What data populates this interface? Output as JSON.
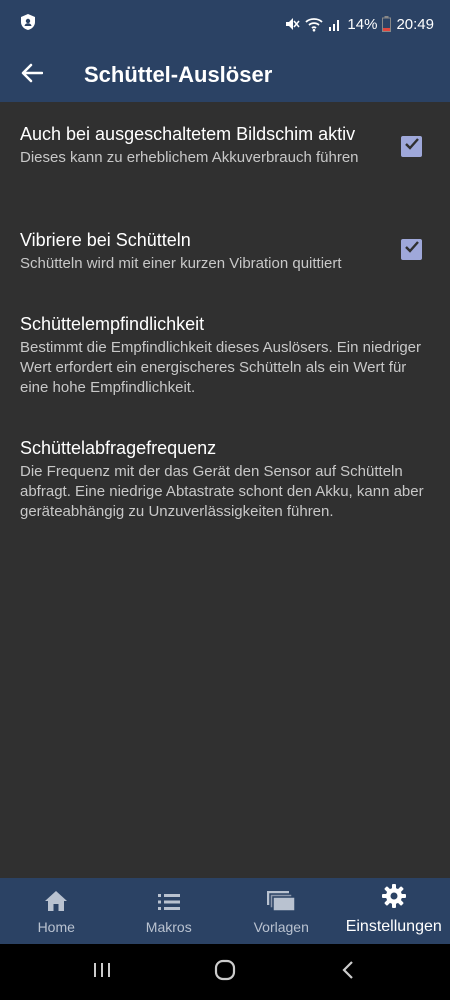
{
  "status_bar": {
    "battery": "14%",
    "time": "20:49"
  },
  "app_bar": {
    "title": "Schüttel-Auslöser"
  },
  "preferences": [
    {
      "title": "Auch bei ausgeschaltetem Bildschim aktiv",
      "summary": "Dieses kann zu erheblichem Akkuverbrauch führen",
      "checked": true
    },
    {
      "title": "Vibriere bei Schütteln",
      "summary": "Schütteln wird mit einer kurzen Vibration quittiert",
      "checked": true
    },
    {
      "title": "Schüttelempfindlichkeit",
      "summary": "Bestimmt die Empfindlichkeit dieses Auslösers. Ein niedriger Wert erfordert ein energischeres Schütteln als ein Wert für eine hohe Empfindlichkeit."
    },
    {
      "title": "Schüttelabfragefrequenz",
      "summary": "Die Frequenz mit der das Gerät den Sensor auf Schütteln abfragt. Eine niedrige Abtastrate schont den Akku, kann aber geräteabhängig zu Unzuverlässigkeiten führen."
    }
  ],
  "bottom_nav": [
    {
      "label": "Home",
      "icon": "home-icon",
      "active": false
    },
    {
      "label": "Makros",
      "icon": "list-icon",
      "active": false
    },
    {
      "label": "Vorlagen",
      "icon": "layers-icon",
      "active": false
    },
    {
      "label": "Einstellungen",
      "icon": "gear-icon",
      "active": true
    }
  ],
  "colors": {
    "app_bar": "#2b4264",
    "background": "#303030",
    "checkbox": "#9fa8da"
  }
}
